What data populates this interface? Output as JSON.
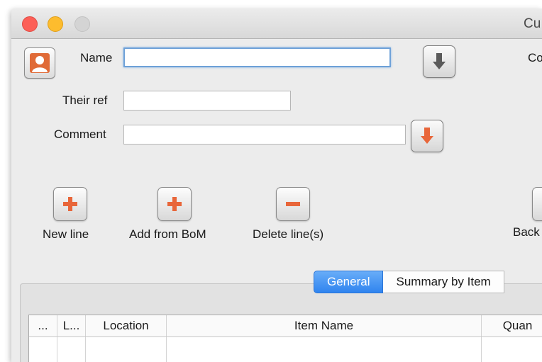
{
  "window": {
    "title": "Cu"
  },
  "form": {
    "name_label": "Name",
    "name_value": "",
    "their_ref_label": "Their ref",
    "their_ref_value": "",
    "comment_label": "Comment",
    "comment_value": "",
    "right_label": "Co"
  },
  "toolbar": {
    "new_line": "New line",
    "add_from_bom": "Add from BoM",
    "delete_lines": "Delete line(s)",
    "back": "Back"
  },
  "tabs": [
    {
      "label": "General",
      "active": true
    },
    {
      "label": "Summary by Item",
      "active": false
    }
  ],
  "table": {
    "columns": [
      "...",
      "L...",
      "Location",
      "Item Name",
      "Quan"
    ]
  },
  "colors": {
    "accent": "#2f84ef",
    "action_orange": "#e8663a"
  },
  "icons": {
    "avatar": "person-icon",
    "name_lookup": "down-arrow-icon",
    "comment_lookup": "down-arrow-icon",
    "new_line": "plus-icon",
    "add_from_bom": "plus-icon",
    "delete_lines": "minus-icon"
  }
}
